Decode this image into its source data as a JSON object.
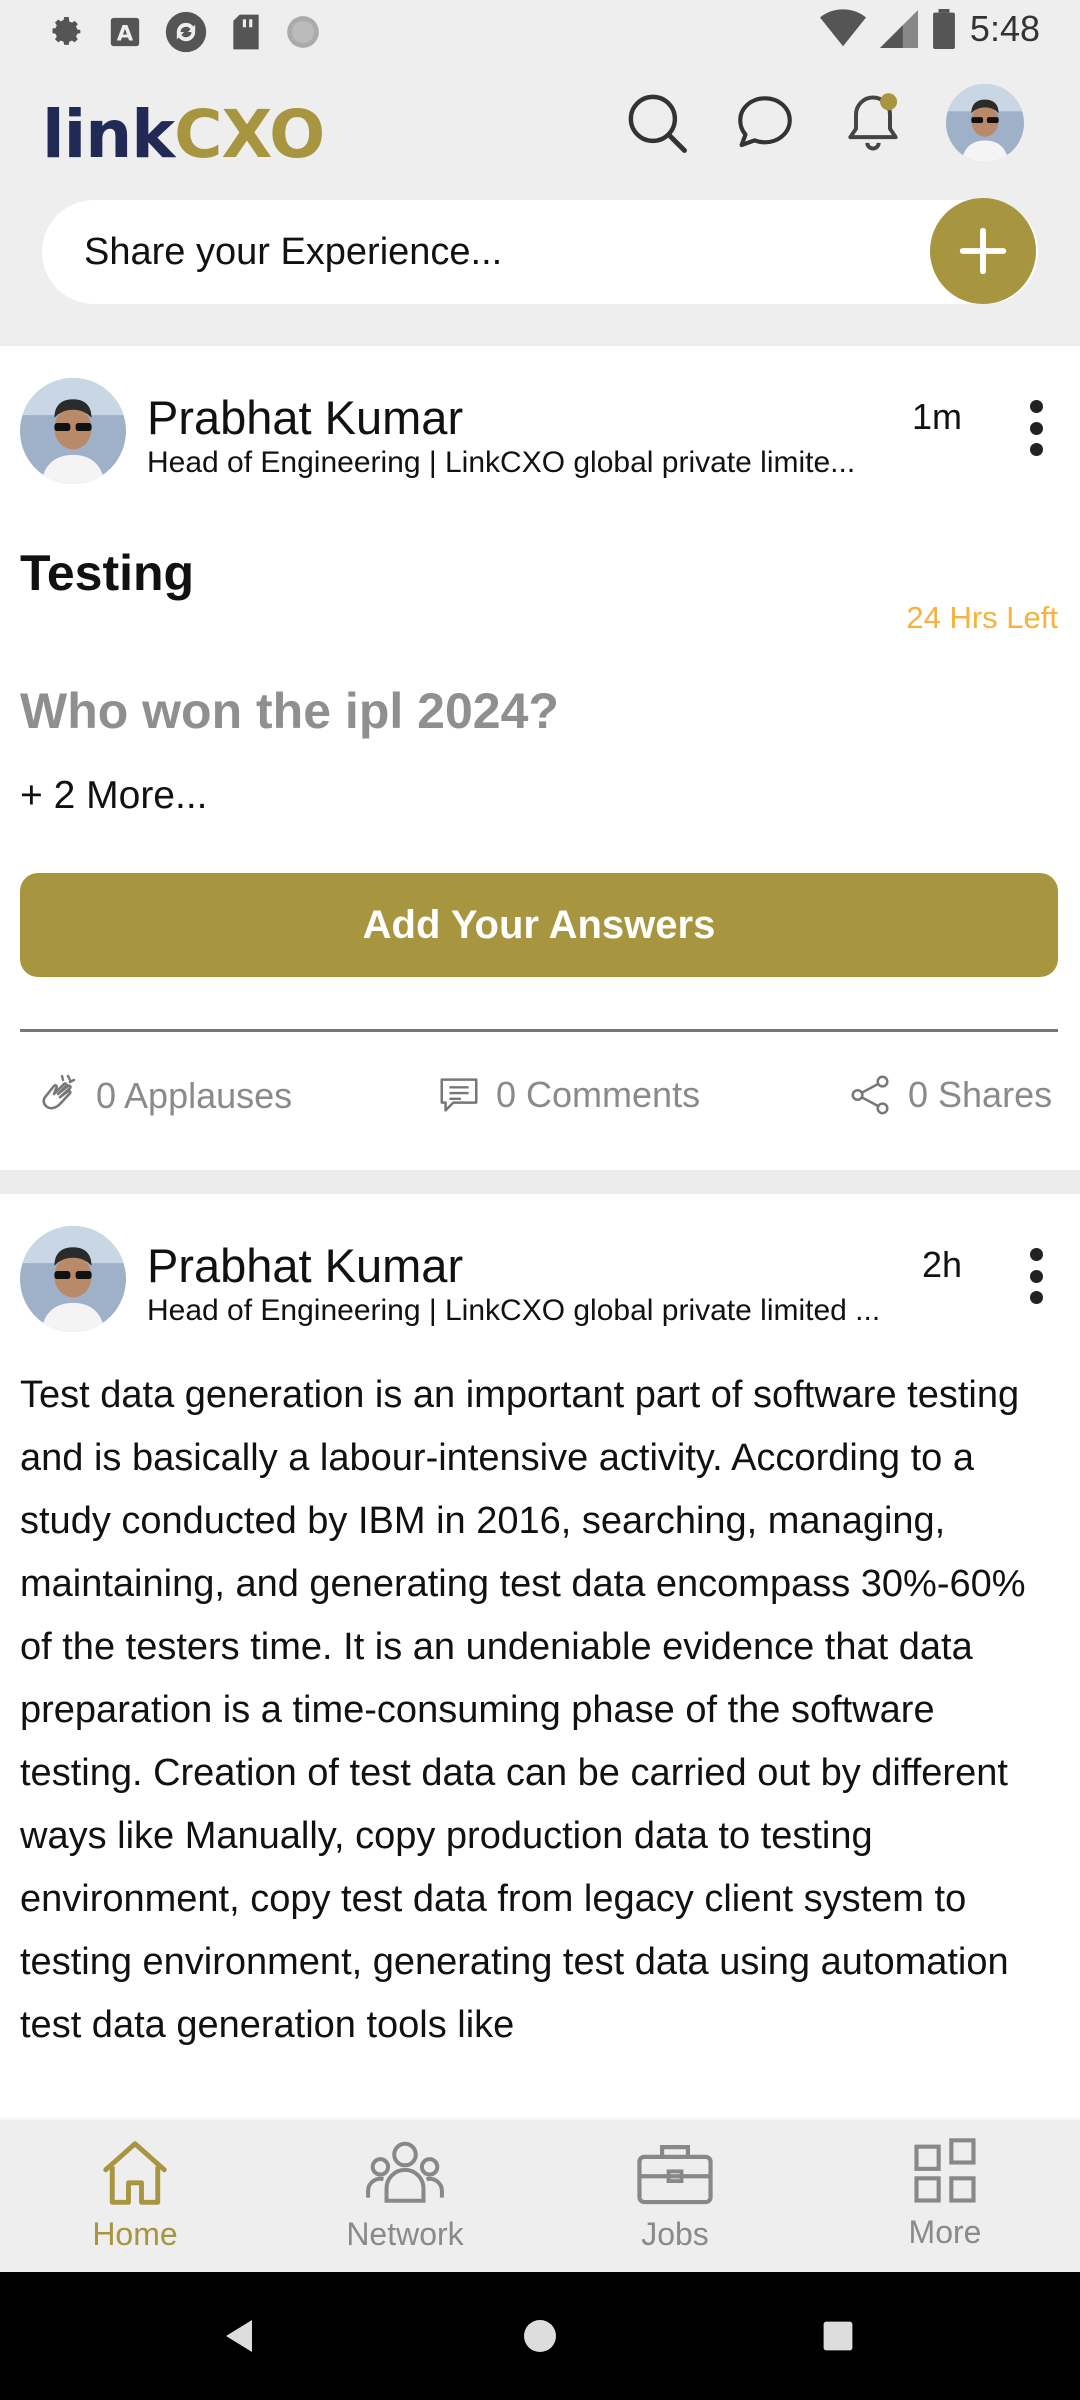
{
  "status_bar": {
    "time": "5:48",
    "left_icons": [
      "settings-icon",
      "a-icon",
      "sync-icon",
      "sd-card-icon",
      "dot-icon"
    ],
    "right_icons": [
      "wifi-icon",
      "signal-icon",
      "battery-icon"
    ]
  },
  "header": {
    "logo_part1": "link",
    "logo_part2": "CXO",
    "icons": [
      "search-icon",
      "chat-icon",
      "bell-icon",
      "avatar"
    ]
  },
  "share": {
    "placeholder": "Share your Experience..."
  },
  "posts": [
    {
      "author": "Prabhat Kumar",
      "title": "Head of Engineering | LinkCXO global private limite...",
      "time": "1m",
      "poll_title": "Testing",
      "timer": "24 Hrs Left",
      "question": "Who won the ipl 2024?",
      "more": "+ 2 More...",
      "answer_button": "Add Your Answers",
      "applauses": "0 Applauses",
      "comments": "0 Comments",
      "shares": "0 Shares"
    },
    {
      "author": "Prabhat Kumar",
      "title": "Head of Engineering | LinkCXO global private limited ...",
      "time": "2h",
      "body": "Test data generation is an important part of software testing and is basically a labour-intensive activity. According to a study conducted by IBM in 2016, searching, managing, maintaining, and generating test data encompass 30%-60% of the testers time. It is an undeniable evidence that data preparation is a time-consuming phase of the software testing. Creation of test data can be carried out by different ways like Manually, copy production data to testing environment, copy test data from legacy client system to testing environment, generating test data using automation test data generation tools like"
    }
  ],
  "bottom_nav": [
    {
      "label": "Home",
      "icon": "home-icon",
      "active": true
    },
    {
      "label": "Network",
      "icon": "network-icon",
      "active": false
    },
    {
      "label": "Jobs",
      "icon": "briefcase-icon",
      "active": false
    },
    {
      "label": "More",
      "icon": "grid-icon",
      "active": false
    }
  ],
  "colors": {
    "accent": "#a8953f",
    "navy": "#202a55",
    "timer": "#f5b23e",
    "muted": "#8a8a8a"
  }
}
